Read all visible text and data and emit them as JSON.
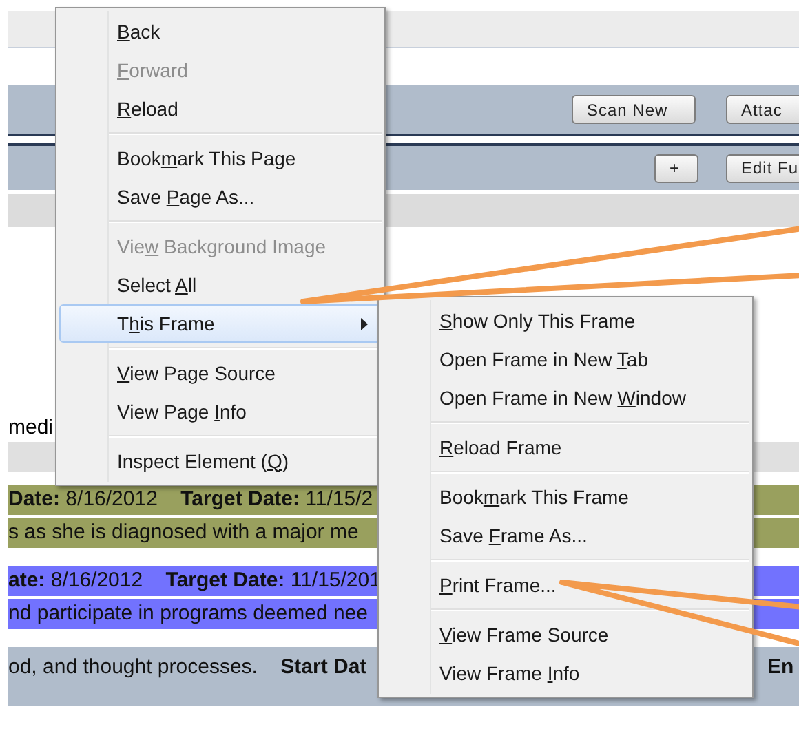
{
  "page": {
    "toolbar_1": {
      "buttons": [
        "Scan New",
        "Attac"
      ]
    },
    "toolbar_2": {
      "buttons": [
        "+",
        "Edit Fu"
      ]
    },
    "fragment": "medi",
    "goals": [
      {
        "color": "#99a05e",
        "lines": [
          "**Date:** 8/16/2012    **Target Date:** 11/15/2",
          "s as she is diagnosed with a major me"
        ]
      },
      {
        "color": "#7272fe",
        "lines": [
          "**ate:** 8/16/2012    **Target Date:** 11/15/201",
          "nd participate in programs deemed nee"
        ]
      }
    ],
    "objective": {
      "text": "od, and thought processes.    **Start Dat**",
      "end_label": "En"
    }
  },
  "context_menu": {
    "groups": [
      [
        {
          "label": {
            "key": "B",
            "post": "ack"
          },
          "disabled": false,
          "selected": false,
          "submenu": false
        },
        {
          "label": {
            "key": "F",
            "post": "orward"
          },
          "disabled": true,
          "selected": false,
          "submenu": false
        },
        {
          "label": {
            "key": "R",
            "post": "eload"
          },
          "disabled": false,
          "selected": false,
          "submenu": false
        }
      ],
      [
        {
          "label": {
            "pre": "Book",
            "key": "m",
            "post": "ark This Page"
          },
          "disabled": false,
          "selected": false,
          "submenu": false
        },
        {
          "label": {
            "pre": "Save ",
            "key": "P",
            "post": "age As..."
          },
          "disabled": false,
          "selected": false,
          "submenu": false
        }
      ],
      [
        {
          "label": {
            "pre": "Vie",
            "key": "w",
            "post": " Background Image"
          },
          "disabled": true,
          "selected": false,
          "submenu": false
        },
        {
          "label": {
            "pre": "Select ",
            "key": "A",
            "post": "ll"
          },
          "disabled": false,
          "selected": false,
          "submenu": false
        },
        {
          "label": {
            "pre": "T",
            "key": "h",
            "post": "is Frame"
          },
          "disabled": false,
          "selected": true,
          "submenu": true
        }
      ],
      [
        {
          "label": {
            "key": "V",
            "post": "iew Page Source"
          },
          "disabled": false,
          "selected": false,
          "submenu": false
        },
        {
          "label": {
            "pre": "View Page ",
            "key": "I",
            "post": "nfo"
          },
          "disabled": false,
          "selected": false,
          "submenu": false
        }
      ],
      [
        {
          "label": {
            "pre": "Inspect Element (",
            "key": "Q",
            "post": ")"
          },
          "disabled": false,
          "selected": false,
          "submenu": false
        }
      ]
    ]
  },
  "submenu": {
    "groups": [
      [
        {
          "label": {
            "key": "S",
            "post": "how Only This Frame"
          },
          "disabled": false,
          "selected": false
        },
        {
          "label": {
            "pre": "Open Frame in New ",
            "key": "T",
            "post": "ab"
          },
          "disabled": false,
          "selected": false
        },
        {
          "label": {
            "pre": "Open Frame in New ",
            "key": "W",
            "post": "indow"
          },
          "disabled": false,
          "selected": false
        }
      ],
      [
        {
          "label": {
            "key": "R",
            "post": "eload Frame"
          },
          "disabled": false,
          "selected": false
        }
      ],
      [
        {
          "label": {
            "pre": "Book",
            "key": "m",
            "post": "ark This Frame"
          },
          "disabled": false,
          "selected": false
        },
        {
          "label": {
            "pre": "Save ",
            "key": "F",
            "post": "rame As..."
          },
          "disabled": false,
          "selected": false
        }
      ],
      [
        {
          "label": {
            "key": "P",
            "post": "rint Frame..."
          },
          "disabled": false,
          "selected": false
        }
      ],
      [
        {
          "label": {
            "key": "V",
            "post": "iew Frame Source"
          },
          "disabled": false,
          "selected": false
        },
        {
          "label": {
            "pre": "View Frame ",
            "key": "I",
            "post": "nfo"
          },
          "disabled": false,
          "selected": false
        }
      ]
    ]
  }
}
